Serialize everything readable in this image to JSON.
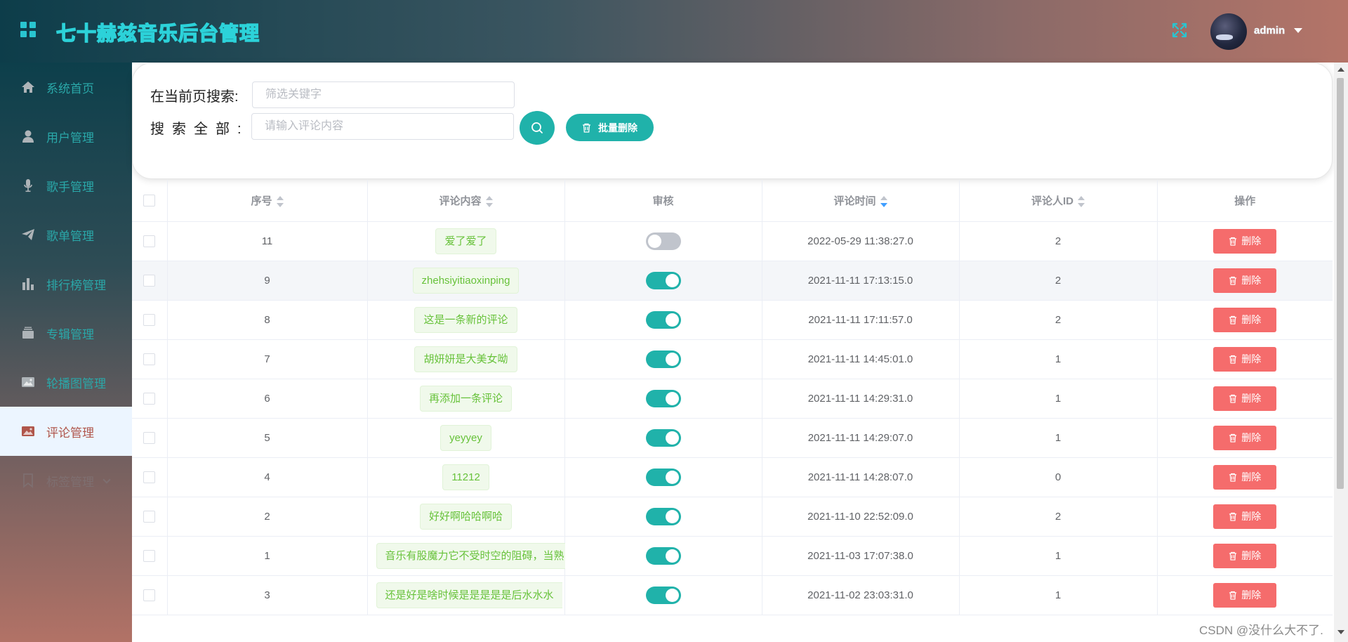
{
  "header": {
    "app_title": "七十赫兹音乐后台管理",
    "user_name": "admin"
  },
  "sidebar": {
    "items": [
      {
        "label": "系统首页",
        "icon": "home-icon",
        "active": false
      },
      {
        "label": "用户管理",
        "icon": "user-icon",
        "active": false
      },
      {
        "label": "歌手管理",
        "icon": "microphone-icon",
        "active": false
      },
      {
        "label": "歌单管理",
        "icon": "paper-plane-icon",
        "active": false
      },
      {
        "label": "排行榜管理",
        "icon": "bar-chart-icon",
        "active": false
      },
      {
        "label": "专辑管理",
        "icon": "album-icon",
        "active": false
      },
      {
        "label": "轮播图管理",
        "icon": "picture-icon",
        "active": false
      },
      {
        "label": "评论管理",
        "icon": "picture-icon",
        "active": true
      },
      {
        "label": "标签管理",
        "icon": "bookmark-icon",
        "active": false,
        "has_submenu": true
      }
    ]
  },
  "search": {
    "current_page_label": "在当前页搜索:",
    "current_page_placeholder": "筛选关键字",
    "all_label": "搜索全部:",
    "all_placeholder": "请输入评论内容",
    "batch_delete_label": "批量删除"
  },
  "table": {
    "columns": [
      "序号",
      "评论内容",
      "审核",
      "评论时间",
      "评论人ID",
      "操作"
    ],
    "sorted_column": "评论时间",
    "sort_direction": "descending",
    "delete_label": "删除",
    "rows": [
      {
        "id": "11",
        "content": "爱了爱了",
        "approved": false,
        "time": "2022-05-29 11:38:27.0",
        "user_id": "2"
      },
      {
        "id": "9",
        "content": "zhehsiyitiaoxinping",
        "approved": true,
        "time": "2021-11-11 17:13:15.0",
        "user_id": "2"
      },
      {
        "id": "8",
        "content": "这是一条新的评论",
        "approved": true,
        "time": "2021-11-11 17:11:57.0",
        "user_id": "2"
      },
      {
        "id": "7",
        "content": "胡妍妍是大美女呦",
        "approved": true,
        "time": "2021-11-11 14:45:01.0",
        "user_id": "1"
      },
      {
        "id": "6",
        "content": "再添加一条评论",
        "approved": true,
        "time": "2021-11-11 14:29:31.0",
        "user_id": "1"
      },
      {
        "id": "5",
        "content": "yeyyey",
        "approved": true,
        "time": "2021-11-11 14:29:07.0",
        "user_id": "1"
      },
      {
        "id": "4",
        "content": "11212",
        "approved": true,
        "time": "2021-11-11 14:28:07.0",
        "user_id": "0"
      },
      {
        "id": "2",
        "content": "好好啊哈哈啊哈",
        "approved": true,
        "time": "2021-11-10 22:52:09.0",
        "user_id": "2"
      },
      {
        "id": "1",
        "content": "音乐有股魔力它不受时空的阻碍，当熟",
        "approved": true,
        "time": "2021-11-03 17:07:38.0",
        "user_id": "1",
        "clipped": true
      },
      {
        "id": "3",
        "content": "还是好是啥时候是是是是是后水水水",
        "approved": true,
        "time": "2021-11-02 23:03:31.0",
        "user_id": "1",
        "clipped": true
      }
    ]
  },
  "watermark": "CSDN @没什么大不了."
}
